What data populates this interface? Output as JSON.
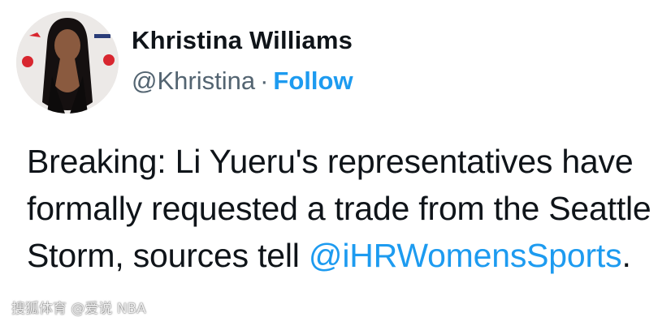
{
  "author": {
    "display_name": "Khristina Williams",
    "handle": "@Khristina",
    "separator": "·",
    "follow_label": "Follow"
  },
  "tweet": {
    "text_before_mention": "Breaking: Li Yueru's representatives have formally requested a trade from the Seattle Storm, sources tell",
    "mention": "@iHRWomensSports",
    "text_after_mention": "."
  },
  "watermark": {
    "text": "搜狐体育 @爱说 NBA"
  },
  "colors": {
    "link": "#1d9bf0",
    "name": "#0f1419",
    "handle": "#536471"
  }
}
